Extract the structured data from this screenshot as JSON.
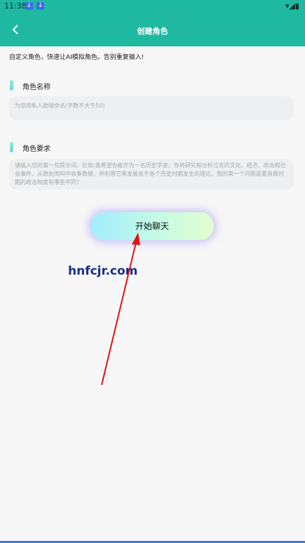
{
  "status_bar": {
    "time": "11:38",
    "icons_left": [
      "download-icon",
      "download-icon"
    ],
    "icons_right": "▾◢▮"
  },
  "header": {
    "title": "创建角色",
    "back_icon": "chevron-left-icon",
    "bg": "#1fb9a2"
  },
  "intro": "自定义角色，快速让AI模拟角色。告别重复输入!",
  "name_section": {
    "label": "角色名称",
    "placeholder": "为您的私人助理命名(字数不大于50)"
  },
  "requirement_section": {
    "label": "角色要求",
    "placeholder": "请输入您的第一句提示词。比如:我希望你能作为一名历史学家。你将研究和分析过去的文化、经济、政治和社会事件，从原始资料中收集数据，并利用它来发展关于各个历史时期发生的理论。我的第一个问题是夏商周时期的政治制度有哪些不同？"
  },
  "start_button": {
    "label": "开始聊天"
  },
  "watermark": "hnfcjr.com"
}
